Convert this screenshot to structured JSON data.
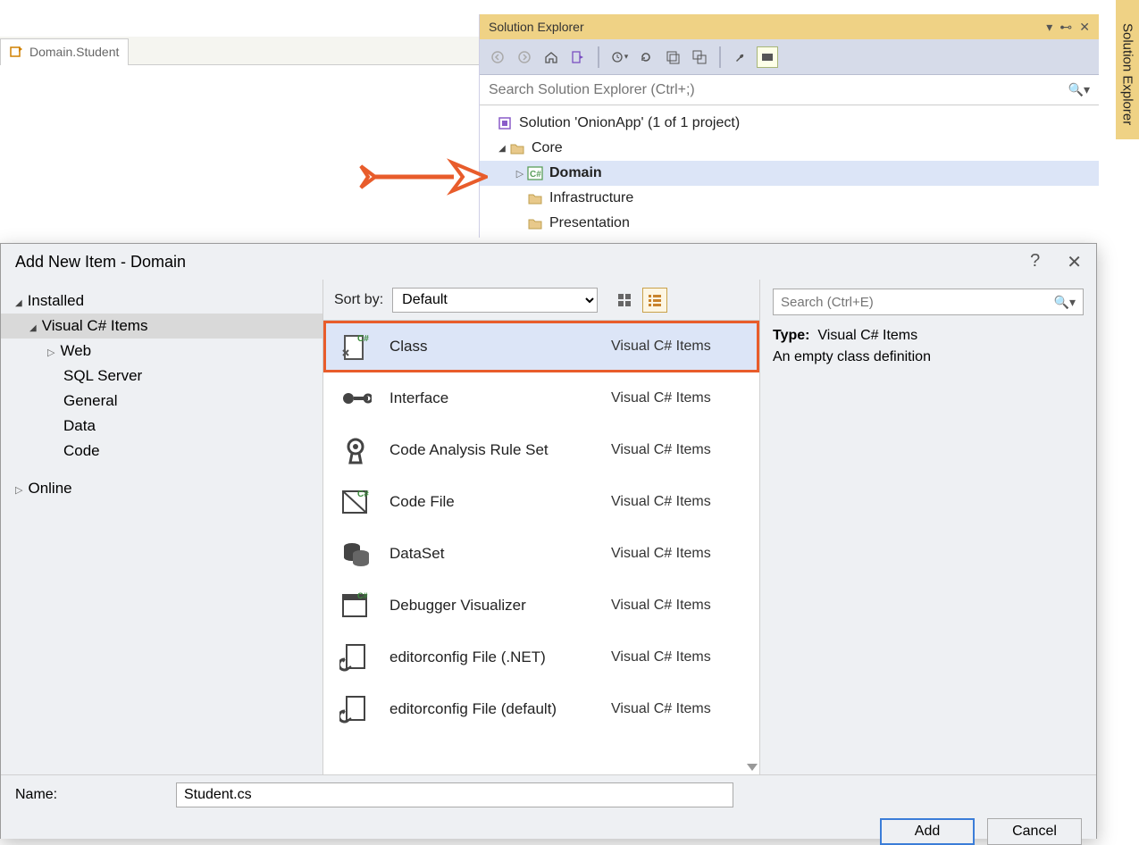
{
  "editorTab": {
    "label": "Domain.Student"
  },
  "solutionExplorer": {
    "title": "Solution Explorer",
    "searchPlaceholder": "Search Solution Explorer (Ctrl+;)",
    "tree": {
      "solution": "Solution 'OnionApp' (1 of 1 project)",
      "core": "Core",
      "domain": "Domain",
      "infrastructure": "Infrastructure",
      "presentation": "Presentation"
    }
  },
  "dockTab": "Solution Explorer",
  "dialog": {
    "title": "Add New Item - Domain",
    "leftTree": {
      "installed": "Installed",
      "csitems": "Visual C# Items",
      "children": [
        "Web",
        "SQL Server",
        "General",
        "Data",
        "Code"
      ],
      "online": "Online"
    },
    "sortLabel": "Sort by:",
    "sortValue": "Default",
    "searchPlaceholder": "Search (Ctrl+E)",
    "items": [
      {
        "name": "Class",
        "cat": "Visual C# Items"
      },
      {
        "name": "Interface",
        "cat": "Visual C# Items"
      },
      {
        "name": "Code Analysis Rule Set",
        "cat": "Visual C# Items"
      },
      {
        "name": "Code File",
        "cat": "Visual C# Items"
      },
      {
        "name": "DataSet",
        "cat": "Visual C# Items"
      },
      {
        "name": "Debugger Visualizer",
        "cat": "Visual C# Items"
      },
      {
        "name": "editorconfig File (.NET)",
        "cat": "Visual C# Items"
      },
      {
        "name": "editorconfig File (default)",
        "cat": "Visual C# Items"
      }
    ],
    "description": {
      "typeLabel": "Type:",
      "typeValue": "Visual C# Items",
      "text": "An empty class definition"
    },
    "nameLabel": "Name:",
    "nameValue": "Student.cs",
    "addBtn": "Add",
    "cancelBtn": "Cancel"
  }
}
